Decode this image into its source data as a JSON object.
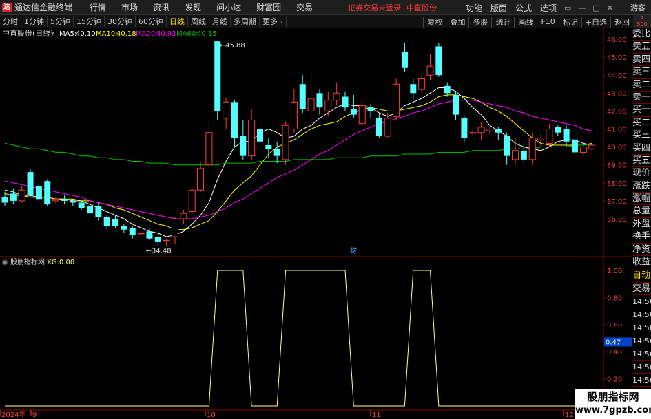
{
  "app": {
    "logo_text": "达",
    "title": "通达信金融终端"
  },
  "menu": [
    "行情",
    "市场",
    "资讯",
    "发现",
    "问小达",
    "财富圈",
    "交易"
  ],
  "warning": {
    "text1": "证券交易未登录",
    "text2": "中直股份"
  },
  "right_menu": [
    "功能",
    "版面",
    "公式",
    "选项"
  ],
  "window_buttons": [
    "▭",
    "—",
    "□",
    "✕"
  ],
  "guest": "游客",
  "periods": [
    "分时",
    "1分钟",
    "5分钟",
    "15分钟",
    "30分钟",
    "60分钟",
    "日线",
    "周线",
    "月线",
    "多周期",
    "更多 ›"
  ],
  "active_period": "日线",
  "toolbar_right": [
    "复权",
    "叠加",
    "多股",
    "统计",
    "画线",
    "F10",
    "标记",
    "+自选",
    "返回"
  ],
  "r_badge": {
    "line1": "R",
    "line2": "500"
  },
  "price_header": {
    "stock": "中直股份(日线)",
    "ma5_label": "MA5:",
    "ma5": "40.10",
    "ma10_label": "MA10:",
    "ma10": "40.18",
    "ma20_label": "MA20:",
    "ma20": "40.93",
    "ma60_label": "MA60:",
    "ma60": "40.15"
  },
  "indicator_header": {
    "name": "股朋指标网",
    "xg_label": "XG:",
    "xg": "0.00"
  },
  "right_panel": {
    "items": [
      "委比",
      "卖五",
      "卖四",
      "卖三",
      "卖二",
      "卖一",
      "买一",
      "买二",
      "买三",
      "买四",
      "买五",
      "现价",
      "涨跌",
      "涨幅",
      "总量",
      "外盘",
      "换手",
      "净资",
      "收益"
    ],
    "lower": [
      "自动",
      "交易",
      "14:56",
      "14:56",
      "14:56",
      "14:56",
      "14:56",
      "14:56",
      "14:56",
      "14:56",
      "14:56",
      "14:56"
    ]
  },
  "watermark": {
    "line1": "股朋指标网",
    "line2": "www.7gpzb.com"
  },
  "colors": {
    "up": "#ff3c3c",
    "down": "#54ffff",
    "ma5": "#ffffff",
    "ma10": "#ffff00",
    "ma20": "#ff00ff",
    "ma60": "#00c000",
    "xg": "#ffff80",
    "grid": "#8b0000"
  },
  "chart_data": [
    {
      "type": "candlestick",
      "title": "中直股份(日线)",
      "y_ticks": [
        "46.00",
        "45.00",
        "44.00",
        "43.00",
        "42.00",
        "41.00",
        "40.00",
        "39.00",
        "38.00",
        "37.00",
        "36.00"
      ],
      "ylim": [
        34.0,
        46.4
      ],
      "x_labels": [
        "2024年",
        "9",
        "10",
        "11",
        "12"
      ],
      "annotations": [
        {
          "text": "45.88",
          "value": 45.88
        },
        {
          "text": "←34.48",
          "value": 34.48
        },
        {
          "text": "财",
          "value": null
        }
      ],
      "candles": [
        {
          "o": 37.2,
          "c": 36.9,
          "h": 37.5,
          "l": 36.7
        },
        {
          "o": 37.4,
          "c": 37.0,
          "h": 37.7,
          "l": 36.8
        },
        {
          "o": 37.0,
          "c": 37.6,
          "h": 37.8,
          "l": 36.9
        },
        {
          "o": 38.6,
          "c": 37.3,
          "h": 38.8,
          "l": 37.2
        },
        {
          "o": 37.8,
          "c": 37.1,
          "h": 38.1,
          "l": 36.9
        },
        {
          "o": 38.1,
          "c": 36.8,
          "h": 38.2,
          "l": 36.7
        },
        {
          "o": 37.0,
          "c": 37.1,
          "h": 37.2,
          "l": 36.8
        },
        {
          "o": 37.1,
          "c": 37.0,
          "h": 37.3,
          "l": 36.8
        },
        {
          "o": 37.0,
          "c": 36.9,
          "h": 37.1,
          "l": 36.7
        },
        {
          "o": 36.9,
          "c": 36.6,
          "h": 37.0,
          "l": 36.5
        },
        {
          "o": 36.7,
          "c": 36.3,
          "h": 36.8,
          "l": 36.1
        },
        {
          "o": 36.7,
          "c": 36.1,
          "h": 36.9,
          "l": 35.9
        },
        {
          "o": 36.1,
          "c": 35.6,
          "h": 36.2,
          "l": 35.4
        },
        {
          "o": 36.0,
          "c": 35.6,
          "h": 36.2,
          "l": 35.5
        },
        {
          "o": 35.6,
          "c": 35.4,
          "h": 35.7,
          "l": 35.2
        },
        {
          "o": 35.5,
          "c": 35.1,
          "h": 35.6,
          "l": 34.9
        },
        {
          "o": 35.2,
          "c": 35.2,
          "h": 35.4,
          "l": 34.8
        },
        {
          "o": 35.3,
          "c": 34.9,
          "h": 35.5,
          "l": 34.8
        },
        {
          "o": 35.0,
          "c": 34.7,
          "h": 35.2,
          "l": 34.5
        },
        {
          "o": 34.8,
          "c": 34.8,
          "h": 34.9,
          "l": 34.48
        },
        {
          "o": 35.0,
          "c": 36.0,
          "h": 36.1,
          "l": 34.6
        },
        {
          "o": 36.0,
          "c": 36.3,
          "h": 36.5,
          "l": 35.7
        },
        {
          "o": 36.4,
          "c": 37.6,
          "h": 37.8,
          "l": 36.2
        },
        {
          "o": 37.6,
          "c": 38.8,
          "h": 39.2,
          "l": 37.5
        },
        {
          "o": 39.0,
          "c": 40.8,
          "h": 41.5,
          "l": 38.8
        },
        {
          "o": 45.88,
          "c": 42.0,
          "h": 45.88,
          "l": 41.5
        },
        {
          "o": 41.6,
          "c": 42.5,
          "h": 42.7,
          "l": 41.0
        },
        {
          "o": 42.5,
          "c": 40.5,
          "h": 42.6,
          "l": 40.0
        },
        {
          "o": 40.6,
          "c": 39.5,
          "h": 41.5,
          "l": 39.3
        },
        {
          "o": 39.5,
          "c": 41.5,
          "h": 42.1,
          "l": 39.3
        },
        {
          "o": 41.0,
          "c": 40.3,
          "h": 41.4,
          "l": 39.8
        },
        {
          "o": 40.1,
          "c": 39.9,
          "h": 40.5,
          "l": 39.4
        },
        {
          "o": 39.9,
          "c": 39.5,
          "h": 40.3,
          "l": 39.1
        },
        {
          "o": 39.3,
          "c": 41.2,
          "h": 41.4,
          "l": 39.0
        },
        {
          "o": 41.0,
          "c": 42.5,
          "h": 43.2,
          "l": 40.8
        },
        {
          "o": 43.5,
          "c": 42.1,
          "h": 44.0,
          "l": 41.9
        },
        {
          "o": 42.0,
          "c": 42.7,
          "h": 44.1,
          "l": 41.5
        },
        {
          "o": 43.0,
          "c": 42.2,
          "h": 43.2,
          "l": 41.8
        },
        {
          "o": 42.0,
          "c": 42.6,
          "h": 43.1,
          "l": 41.7
        },
        {
          "o": 42.6,
          "c": 43.0,
          "h": 43.6,
          "l": 42.3
        },
        {
          "o": 42.8,
          "c": 42.2,
          "h": 43.1,
          "l": 42.0
        },
        {
          "o": 42.1,
          "c": 41.8,
          "h": 42.9,
          "l": 41.6
        },
        {
          "o": 41.3,
          "c": 42.3,
          "h": 42.6,
          "l": 41.1
        },
        {
          "o": 42.2,
          "c": 42.0,
          "h": 42.4,
          "l": 41.6
        },
        {
          "o": 41.6,
          "c": 40.6,
          "h": 41.9,
          "l": 40.5
        },
        {
          "o": 40.6,
          "c": 41.6,
          "h": 41.9,
          "l": 40.5
        },
        {
          "o": 41.7,
          "c": 43.5,
          "h": 43.8,
          "l": 41.5
        },
        {
          "o": 45.3,
          "c": 44.4,
          "h": 45.8,
          "l": 44.2
        },
        {
          "o": 43.5,
          "c": 43.0,
          "h": 43.8,
          "l": 42.6
        },
        {
          "o": 43.2,
          "c": 43.8,
          "h": 44.1,
          "l": 43.0
        },
        {
          "o": 44.0,
          "c": 44.5,
          "h": 45.2,
          "l": 43.7
        },
        {
          "o": 45.6,
          "c": 44.0,
          "h": 45.8,
          "l": 43.9
        },
        {
          "o": 43.4,
          "c": 43.0,
          "h": 43.6,
          "l": 42.8
        },
        {
          "o": 42.9,
          "c": 41.8,
          "h": 43.1,
          "l": 41.5
        },
        {
          "o": 41.6,
          "c": 40.5,
          "h": 41.7,
          "l": 40.3
        },
        {
          "o": 40.8,
          "c": 40.8,
          "h": 41.0,
          "l": 40.6
        },
        {
          "o": 40.8,
          "c": 41.1,
          "h": 41.4,
          "l": 40.4
        },
        {
          "o": 40.9,
          "c": 41.0,
          "h": 41.1,
          "l": 40.7
        },
        {
          "o": 41.0,
          "c": 40.8,
          "h": 41.1,
          "l": 40.4
        },
        {
          "o": 40.6,
          "c": 39.5,
          "h": 40.8,
          "l": 39.0
        },
        {
          "o": 39.3,
          "c": 39.8,
          "h": 40.5,
          "l": 39.0
        },
        {
          "o": 39.8,
          "c": 39.3,
          "h": 40.3,
          "l": 39.0
        },
        {
          "o": 39.3,
          "c": 40.5,
          "h": 40.8,
          "l": 39.0
        },
        {
          "o": 40.4,
          "c": 40.5,
          "h": 40.7,
          "l": 40.0
        },
        {
          "o": 40.2,
          "c": 41.0,
          "h": 41.3,
          "l": 40.0
        },
        {
          "o": 41.1,
          "c": 40.8,
          "h": 41.2,
          "l": 40.6
        },
        {
          "o": 41.0,
          "c": 40.3,
          "h": 41.2,
          "l": 40.0
        },
        {
          "o": 40.4,
          "c": 39.7,
          "h": 40.5,
          "l": 39.5
        },
        {
          "o": 39.7,
          "c": 40.0,
          "h": 40.1,
          "l": 39.5
        },
        {
          "o": 39.9,
          "c": 40.1,
          "h": 40.3,
          "l": 39.8
        }
      ],
      "series": [
        {
          "name": "MA5",
          "values": [
            37.6,
            37.5,
            37.3,
            37.3,
            37.2,
            37.2,
            37.1,
            37.1,
            37.0,
            37.0,
            36.8,
            36.6,
            36.4,
            36.2,
            36.0,
            35.7,
            35.5,
            35.3,
            35.2,
            35.0,
            35.1,
            35.3,
            35.7,
            36.2,
            36.9,
            38.2,
            39.2,
            40.0,
            40.3,
            40.3,
            40.8,
            41.0,
            40.8,
            40.5,
            40.6,
            41.0,
            41.2,
            41.6,
            41.9,
            42.2,
            42.4,
            42.3,
            42.3,
            42.2,
            41.9,
            41.7,
            41.9,
            42.3,
            42.5,
            42.7,
            43.0,
            43.3,
            43.3,
            43.1,
            42.7,
            42.2,
            41.8,
            41.2,
            40.9,
            40.6,
            40.2,
            40.0,
            39.9,
            39.8,
            40.0,
            40.3,
            40.4,
            40.4,
            40.2,
            40.1
          ]
        },
        {
          "name": "MA10",
          "values": [
            37.4,
            37.3,
            37.3,
            37.2,
            37.2,
            37.2,
            37.1,
            37.1,
            37.1,
            37.0,
            37.0,
            36.9,
            36.8,
            36.6,
            36.5,
            36.3,
            36.1,
            35.9,
            35.7,
            35.6,
            35.4,
            35.4,
            35.5,
            35.7,
            35.9,
            36.4,
            37.0,
            37.6,
            38.0,
            38.4,
            39.0,
            39.6,
            40.0,
            40.2,
            40.4,
            40.7,
            41.0,
            41.2,
            41.3,
            41.4,
            41.7,
            41.9,
            42.1,
            42.2,
            42.1,
            42.0,
            42.0,
            42.1,
            42.2,
            42.3,
            42.5,
            42.8,
            42.9,
            42.9,
            42.8,
            42.7,
            42.5,
            42.2,
            42.0,
            41.7,
            41.3,
            40.9,
            40.5,
            40.2,
            40.1,
            40.1,
            40.1,
            40.1,
            40.1,
            40.2
          ]
        },
        {
          "name": "MA20",
          "values": [
            38.1,
            38.0,
            37.9,
            37.8,
            37.7,
            37.6,
            37.5,
            37.4,
            37.3,
            37.2,
            37.0,
            36.9,
            36.8,
            36.7,
            36.6,
            36.5,
            36.4,
            36.3,
            36.2,
            36.1,
            36.0,
            36.0,
            36.0,
            36.1,
            36.2,
            36.4,
            36.6,
            36.9,
            37.1,
            37.4,
            37.7,
            38.0,
            38.3,
            38.5,
            38.7,
            39.0,
            39.3,
            39.6,
            39.8,
            40.1,
            40.4,
            40.7,
            40.9,
            41.1,
            41.3,
            41.4,
            41.6,
            41.7,
            41.9,
            42.0,
            42.2,
            42.4,
            42.5,
            42.6,
            42.6,
            42.6,
            42.5,
            42.4,
            42.3,
            42.2,
            42.0,
            41.9,
            41.7,
            41.6,
            41.5,
            41.4,
            41.3,
            41.2,
            41.0,
            40.9
          ]
        },
        {
          "name": "MA60",
          "values": [
            40.2,
            40.1,
            40.0,
            39.9,
            39.9,
            39.8,
            39.7,
            39.7,
            39.6,
            39.5,
            39.5,
            39.4,
            39.4,
            39.3,
            39.3,
            39.2,
            39.2,
            39.1,
            39.1,
            39.1,
            39.0,
            39.0,
            39.0,
            39.0,
            39.0,
            39.0,
            39.1,
            39.1,
            39.1,
            39.1,
            39.2,
            39.2,
            39.2,
            39.2,
            39.3,
            39.3,
            39.3,
            39.3,
            39.3,
            39.4,
            39.4,
            39.4,
            39.4,
            39.5,
            39.5,
            39.5,
            39.5,
            39.6,
            39.6,
            39.6,
            39.6,
            39.7,
            39.7,
            39.7,
            39.7,
            39.8,
            39.8,
            39.8,
            39.8,
            39.9,
            39.9,
            39.9,
            39.9,
            40.0,
            40.0,
            40.0,
            40.0,
            40.1,
            40.1,
            40.15
          ]
        }
      ]
    },
    {
      "type": "line",
      "title": "股朋指标网",
      "y_ticks": [
        "1.00",
        "0.80",
        "0.60",
        "0.40",
        "0.20",
        "0.00"
      ],
      "ylim": [
        0,
        1.1
      ],
      "cursor_value": "0.47",
      "series": [
        {
          "name": "XG",
          "values": [
            0,
            0,
            0,
            0,
            0,
            0,
            0,
            0,
            0,
            0,
            0,
            0,
            0,
            0,
            0,
            0,
            0,
            0,
            0,
            0,
            0,
            0,
            0,
            0,
            0,
            1,
            1,
            1,
            1,
            0,
            0,
            0,
            0,
            1,
            1,
            1,
            1,
            1,
            1,
            1,
            1,
            0,
            0,
            0,
            0,
            0,
            0,
            0,
            1,
            1,
            1,
            0,
            0,
            0,
            0,
            0,
            0,
            0,
            0,
            0,
            0,
            0,
            0,
            0,
            0,
            0,
            0,
            0,
            0,
            0
          ]
        }
      ]
    }
  ]
}
